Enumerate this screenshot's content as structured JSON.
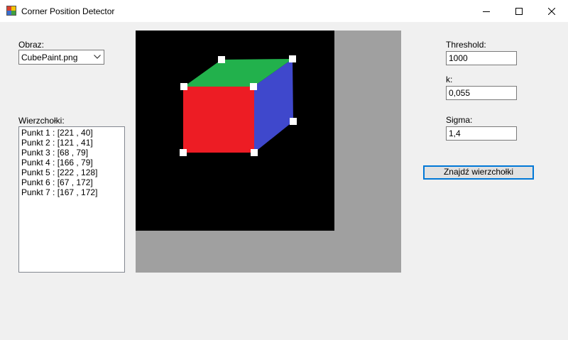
{
  "window": {
    "title": "Corner Position Detector",
    "controls": [
      "minimize-icon",
      "maximize-icon",
      "close-icon"
    ]
  },
  "image_select": {
    "label": "Obraz:",
    "selected": "CubePaint.png",
    "icon": "chevron-down-icon"
  },
  "vertices": {
    "label": "Wierzchołki:",
    "items": [
      "Punkt 1 : [221 , 40]",
      "Punkt 2 : [121 , 41]",
      "Punkt 3 : [68 , 79]",
      "Punkt 4 : [166 , 79]",
      "Punkt 5 : [222 , 128]",
      "Punkt 6 : [67 , 172]",
      "Punkt 7 : [167 , 172]"
    ]
  },
  "params": {
    "threshold_label": "Threshold:",
    "threshold_value": "1000",
    "k_label": "k:",
    "k_value": "0,055",
    "sigma_label": "Sigma:",
    "sigma_value": "1,4"
  },
  "actions": {
    "find_label": "Znajdź wierzchołki"
  },
  "colors": {
    "canvas_bg": "#a0a0a0",
    "image_bg": "#000000",
    "cube_front": "#ed1c24",
    "cube_top": "#22b14c",
    "cube_side": "#3f48cc",
    "marker": "#ffffff"
  }
}
